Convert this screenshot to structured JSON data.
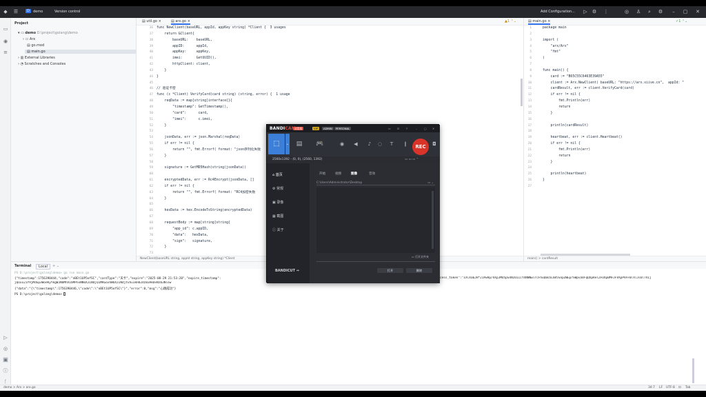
{
  "titlebar": {
    "project_badge": "D",
    "project_name": "demo",
    "vcs": "Version control",
    "run_config": "Add Configuration..."
  },
  "project_panel": {
    "title": "Project",
    "root_name": "demo",
    "root_path": "D:\\project\\golang\\demo",
    "items": [
      "Arx",
      "go.mod",
      "main.go",
      "External Libraries",
      "Scratches and Consoles"
    ]
  },
  "editor1": {
    "tabs": [
      "util.go",
      "arx.go"
    ],
    "gutter": [
      "36",
      "37",
      "38",
      "39",
      "40",
      "41",
      "42",
      "43",
      "44",
      "45",
      "46",
      "47",
      "48",
      "49",
      "50",
      "51",
      "52",
      "53",
      "54",
      "55",
      "56",
      "57",
      "58",
      "59",
      "60",
      "61",
      "62",
      "63",
      "64",
      "65",
      "66",
      "67",
      "68",
      "69",
      "70",
      "71",
      "72",
      "73"
    ],
    "lines": [
      "func NewClient(baseURL, appId, appKey string) *Client {  3 usages",
      "    return &Client{",
      "        baseURL:    baseURL,",
      "        appID:      appId,",
      "        appKey:     appKey,",
      "        imei:       GetUUID(),",
      "        httpClient: client,",
      "    }",
      "}",
      "",
      "// 验证卡密",
      "func (c *Client) VerifyCard(card string) (string, error) {  1 usage",
      "    reqData := map[string]interface{}{",
      "        \"timestamp\": GetTimestamp(),",
      "        \"card\":      card,",
      "        \"imei\":      c.imei,",
      "    }",
      "",
      "    jsonData, err := json.Marshal(reqData)",
      "    if err != nil {",
      "        return \"\", fmt.Errorf( format: \"json序列化失败",
      "    }",
      "",
      "    signature := GetMD5Hash(string(jsonData))",
      "",
      "    encryptedData, err := Rc4Encrypt(jsonData, []",
      "    if err != nil {",
      "        return \"\", fmt.Errorf( format: \"RC4加密失败",
      "    }",
      "",
      "    hexData := hex.EncodeToString(encryptedData)",
      "",
      "    requestBody := map[string]string{",
      "        \"app_id\": c.appID,",
      "        \"data\":   hexData,",
      "        \"sign\":   signature,",
      "    }",
      ""
    ],
    "breadcrumb": "NewClient(baseURL string, appId string, appKey string) *Client"
  },
  "editor2": {
    "tabs": [
      "main.go"
    ],
    "gutter": [
      "1",
      "2",
      "3",
      "4",
      "5",
      "6",
      "7",
      "8",
      "9",
      "10",
      "11",
      "12",
      "13",
      "14",
      "15",
      "16",
      "17",
      "18",
      "19",
      "20",
      "21",
      "22",
      "23",
      "24",
      "25",
      "26",
      "27"
    ],
    "lines": [
      "package main",
      "",
      "import (",
      "    \"arx/Arx\"",
      "    \"fmt\"",
      ")",
      "",
      "func main() {",
      "    card := \"B65C55C6463E39A55\"",
      "    client := Arx.NewClient( baseURL: \"https://arx.xiive.cn\",  appId: \"",
      "    cardResult, err := client.VerifyCard(card)",
      "    if err != nil {",
      "        fmt.Println(err)",
      "        return",
      "    }",
      "",
      "    println(cardResult)",
      "",
      "    heartbeat, err := client.Heartbeat()",
      "    if err != nil {",
      "        fmt.Println(err)",
      "        return",
      "    }",
      "",
      "    println(heartbeat)",
      "}",
      ""
    ],
    "breadcrumb": "main()  >  cardResult"
  },
  "terminal": {
    "title": "Terminal",
    "tab": "Local",
    "lines": [
      "PS D:\\project\\golang\\demo> go run main.go",
      "{\"timestamp\":1756390444,\"code\":\"nBEt1UP5ofSC\",\"cardType\":\"天卡\",\"expire\":\"2025-08-29 21:53:20\",\"expire_timestamp\":",
      "cess_token\":\"IXlXa6JH*21Pw9p/VXpJMU5pSXNJUIIiYXNNNwlrcFhuQ0o5LmV5SnpZWEprSWpvaVFqQXpRelZFUXpBMFJFVXpPVFF0TXlJsOlTVIj",
      "jQoxx21Y9jMdGp3WoeKyYkgWJNUMhVIbMPnxNNUXJINdjQ1MRGoxhWUXJINdjtvhu1kHd2dzB3Ak0vNzb3Nlow",
      "{\"data\":\"{\\\"timestamp\\\":1756390446,\\\"code\\\":\\\"nBEt1UP5ofSC\\\"}\",\"error\":0,\"msg\":\"心跳成功\"}",
      "PS D:\\project\\golang\\demo> "
    ]
  },
  "statusbar": {
    "left": "demo  >  Arx  >  arx.go",
    "pos": "34:7",
    "lf": "LF",
    "enc": "UTF-8",
    "indent": "Tab"
  },
  "bandicam": {
    "logo_a": "BANDI",
    "logo_b": "CAM",
    "badge1": "试用版",
    "badge2": "VIP",
    "badge3": "ADMIN",
    "badge4": "PERSONAL",
    "rec": "REC",
    "resolution": "2560x1392 - (0, 0), (2560, 1392)",
    "side": [
      "首页",
      "常规",
      "录像",
      "截图",
      "关于"
    ],
    "tabs": [
      "开始",
      "视频",
      "图像",
      "音效"
    ],
    "path": "C:\\Users\\Administrator\\Desktop",
    "open_btn": "打开",
    "delete_btn": "删除",
    "open_folder": "打开文件夹",
    "bottom_logo": "BANDICUT"
  }
}
